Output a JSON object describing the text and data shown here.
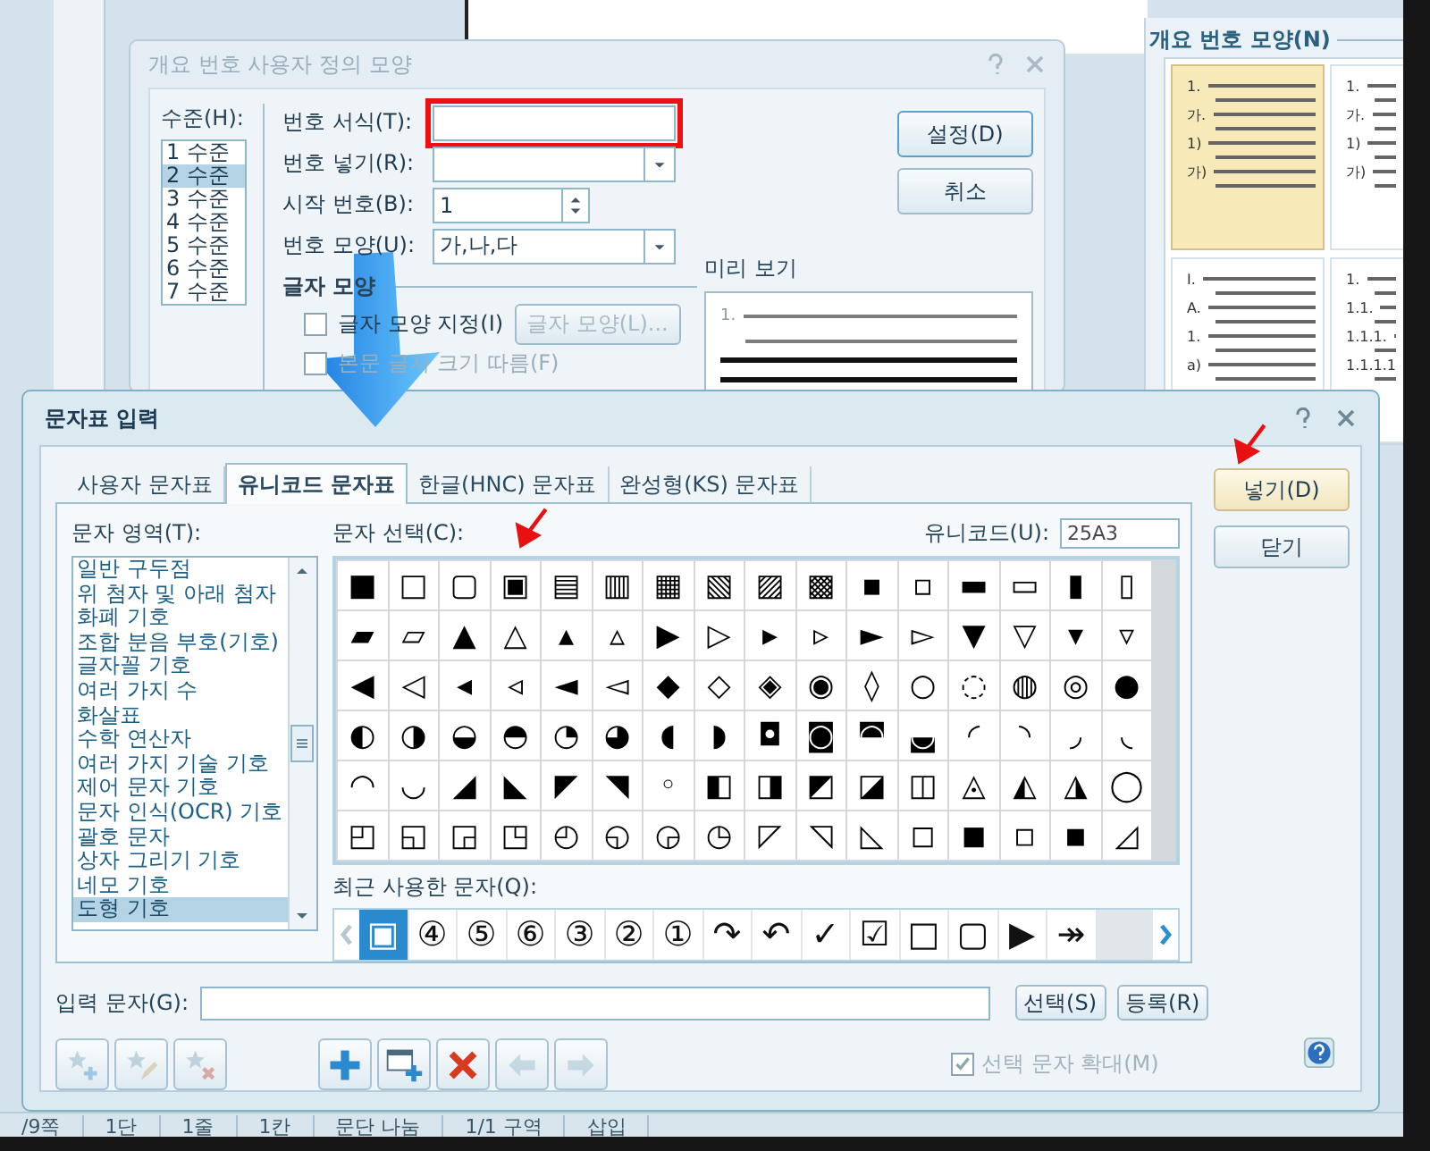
{
  "outline_dialog": {
    "title": "개요 번호 사용자 정의 모양",
    "level_label": "수준(H):",
    "levels": [
      {
        "label": "1 수준",
        "selected": false
      },
      {
        "label": "2 수준",
        "selected": true
      },
      {
        "label": "3 수준",
        "selected": false
      },
      {
        "label": "4 수준",
        "selected": false
      },
      {
        "label": "5 수준",
        "selected": false
      },
      {
        "label": "6 수준",
        "selected": false
      },
      {
        "label": "7 수준",
        "selected": false
      }
    ],
    "fields": [
      {
        "kind": "text",
        "label": "번호 서식(T):",
        "highlighted": true
      },
      {
        "kind": "dropdown",
        "label": "번호 넣기(R):",
        "highlighted": false
      },
      {
        "kind": "spinner",
        "label": "시작 번호(B):",
        "value": "1",
        "highlighted": false
      },
      {
        "kind": "dropdown",
        "label": "번호 모양(U):",
        "value": "가,나,다",
        "highlighted": false
      }
    ],
    "buttons": [
      {
        "label": "설정(D)",
        "default": true
      },
      {
        "label": "취소",
        "default": false
      }
    ],
    "char_section": "글자 모양",
    "char_check": {
      "label": "글자 모양 지정(I)",
      "checked": false
    },
    "char_button": "글자 모양(L)...",
    "size_check": {
      "label": "본문 글자 크기 따름(F)",
      "checked": false
    },
    "preview_label": "미리 보기",
    "preview_number": "1."
  },
  "outline_panel": {
    "title": "개요 번호 모양(N)",
    "styles": [
      {
        "selected": true,
        "lines": [
          "1.",
          "가.",
          "1)",
          "가)"
        ]
      },
      {
        "selected": false,
        "lines": [
          "1.",
          "가.",
          "1)",
          "가)"
        ]
      },
      {
        "selected": false,
        "lines": [
          "I.",
          "A.",
          "1.",
          "a)"
        ]
      },
      {
        "selected": false,
        "lines": [
          "1.",
          "1.1.",
          "1.1.1.",
          "1.1.1.1"
        ]
      }
    ]
  },
  "char_map": {
    "title": "문자표 입력",
    "tabs": [
      {
        "label": "사용자 문자표",
        "selected": false
      },
      {
        "label": "유니코드 문자표",
        "selected": true
      },
      {
        "label": "한글(HNC) 문자표",
        "selected": false
      },
      {
        "label": "완성형(KS) 문자표",
        "selected": false
      }
    ],
    "buttons": [
      {
        "label": "넣기(D)",
        "default": true
      },
      {
        "label": "닫기",
        "default": false
      }
    ],
    "area_label": "문자 영역(T):",
    "areas": [
      {
        "label": "일반 구두점",
        "selected": false
      },
      {
        "label": "위 첨자 및 아래 첨자",
        "selected": false
      },
      {
        "label": "화폐 기호",
        "selected": false
      },
      {
        "label": "조합 분음 부호(기호)",
        "selected": false
      },
      {
        "label": "글자꼴 기호",
        "selected": false
      },
      {
        "label": "여러 가지 수",
        "selected": false
      },
      {
        "label": "화살표",
        "selected": false
      },
      {
        "label": "수학 연산자",
        "selected": false
      },
      {
        "label": "여러 가지 기술 기호",
        "selected": false
      },
      {
        "label": "제어 문자 기호",
        "selected": false
      },
      {
        "label": "문자 인식(OCR) 기호",
        "selected": false
      },
      {
        "label": "괄호 문자",
        "selected": false
      },
      {
        "label": "상자 그리기 기호",
        "selected": false
      },
      {
        "label": "네모 기호",
        "selected": false
      },
      {
        "label": "도형 기호",
        "selected": true
      }
    ],
    "select_label": "문자 선택(C):",
    "unicode_label": "유니코드(U):",
    "unicode_value": "25A3",
    "grid": [
      [
        "■",
        "□",
        "▢",
        "▣",
        "▤",
        "▥",
        "▦",
        "▧",
        "▨",
        "▩",
        "▪",
        "▫",
        "▬",
        "▭",
        "▮",
        "▯"
      ],
      [
        "▰",
        "▱",
        "▲",
        "△",
        "▴",
        "▵",
        "▶",
        "▷",
        "▸",
        "▹",
        "►",
        "▻",
        "▼",
        "▽",
        "▾",
        "▿"
      ],
      [
        "◀",
        "◁",
        "◂",
        "◃",
        "◄",
        "◅",
        "◆",
        "◇",
        "◈",
        "◉",
        "◊",
        "○",
        "◌",
        "◍",
        "◎",
        "●"
      ],
      [
        "◐",
        "◑",
        "◒",
        "◓",
        "◔",
        "◕",
        "◖",
        "◗",
        "◘",
        "◙",
        "◚",
        "◛",
        "◜",
        "◝",
        "◞",
        "◟"
      ],
      [
        "◠",
        "◡",
        "◢",
        "◣",
        "◤",
        "◥",
        "◦",
        "◧",
        "◨",
        "◩",
        "◪",
        "◫",
        "◬",
        "◭",
        "◮",
        "◯"
      ],
      [
        "◰",
        "◱",
        "◲",
        "◳",
        "◴",
        "◵",
        "◶",
        "◷",
        "◸",
        "◹",
        "◺",
        "◻",
        "◼",
        "◽",
        "◾",
        "◿"
      ]
    ],
    "recent_label": "최근 사용한 문자(Q):",
    "recent": [
      {
        "char": "▣",
        "selected": true
      },
      {
        "char": "④",
        "selected": false
      },
      {
        "char": "⑤",
        "selected": false
      },
      {
        "char": "⑥",
        "selected": false
      },
      {
        "char": "③",
        "selected": false
      },
      {
        "char": "②",
        "selected": false
      },
      {
        "char": "①",
        "selected": false
      },
      {
        "char": "↷",
        "selected": false
      },
      {
        "char": "↶",
        "selected": false
      },
      {
        "char": "✓",
        "selected": false
      },
      {
        "char": "☑",
        "selected": false
      },
      {
        "char": "□",
        "selected": false
      },
      {
        "char": "▢",
        "selected": false
      },
      {
        "char": "▶",
        "selected": false
      },
      {
        "char": "↠",
        "selected": false
      }
    ],
    "input_label": "입력 문자(G):",
    "input_buttons": [
      "선택(S)",
      "등록(R)"
    ],
    "tools": [
      {
        "kind": "star-add",
        "disabled": true
      },
      {
        "kind": "star-edit",
        "disabled": true
      },
      {
        "kind": "star-delete",
        "disabled": true
      },
      {
        "kind": "add",
        "disabled": false
      },
      {
        "kind": "window-add",
        "disabled": false
      },
      {
        "kind": "delete",
        "disabled": false
      },
      {
        "kind": "left",
        "disabled": true
      },
      {
        "kind": "right",
        "disabled": true
      }
    ],
    "enlarge": {
      "label": "선택 문자 확대(M)",
      "checked": true,
      "disabled": true
    }
  },
  "status_bar": [
    "/9쪽",
    "1단",
    "1줄",
    "1칸",
    "문단 나눔",
    "1/1 구역",
    "삽입"
  ]
}
